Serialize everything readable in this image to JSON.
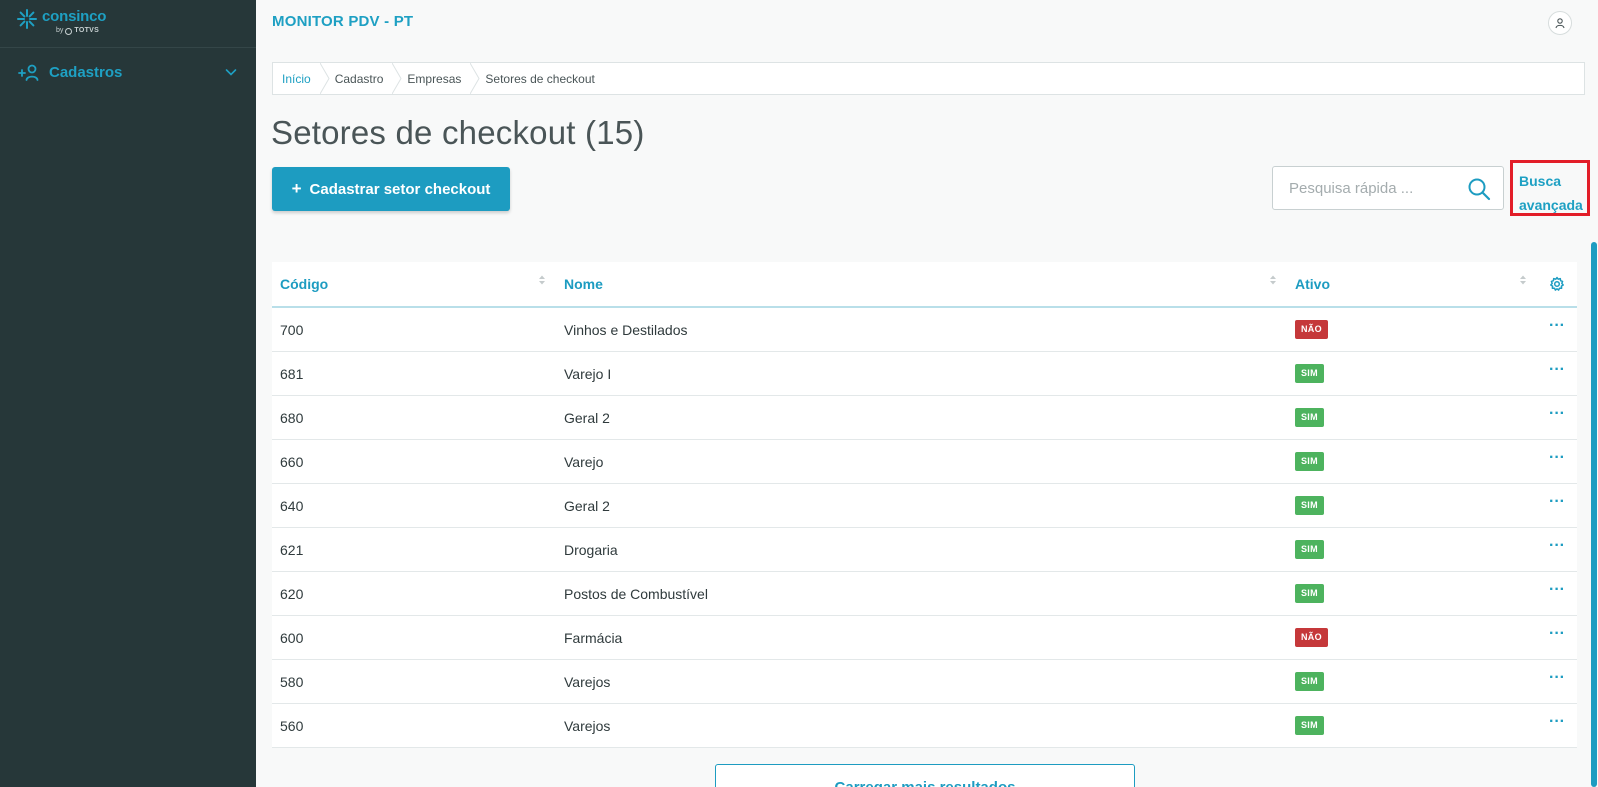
{
  "brand": {
    "name": "consinco",
    "by": "by",
    "parent": "TOTVS",
    "accent": "#1ea0c3"
  },
  "sidebar": {
    "items": [
      {
        "label": "Cadastros",
        "icon": "add-user-icon"
      }
    ]
  },
  "header": {
    "app_title": "MONITOR PDV - PT"
  },
  "breadcrumb": [
    "Início",
    "Cadastro",
    "Empresas",
    "Setores de checkout"
  ],
  "page": {
    "title": "Setores de checkout (15)"
  },
  "toolbar": {
    "add_label": "Cadastrar setor checkout",
    "add_plus": "+",
    "search_placeholder": "Pesquisa rápida ...",
    "advanced_search_line1": "Busca",
    "advanced_search_line2": "avançada"
  },
  "table": {
    "columns": [
      "Código",
      "Nome",
      "Ativo"
    ],
    "rows": [
      {
        "code": "700",
        "name": "Vinhos e Destilados",
        "active": "NÃO"
      },
      {
        "code": "681",
        "name": "Varejo I",
        "active": "SIM"
      },
      {
        "code": "680",
        "name": "Geral 2",
        "active": "SIM"
      },
      {
        "code": "660",
        "name": "Varejo",
        "active": "SIM"
      },
      {
        "code": "640",
        "name": "Geral 2",
        "active": "SIM"
      },
      {
        "code": "621",
        "name": "Drogaria",
        "active": "SIM"
      },
      {
        "code": "620",
        "name": "Postos de Combustível",
        "active": "SIM"
      },
      {
        "code": "600",
        "name": "Farmácia",
        "active": "NÃO"
      },
      {
        "code": "580",
        "name": "Varejos",
        "active": "SIM"
      },
      {
        "code": "560",
        "name": "Varejos",
        "active": "SIM"
      }
    ],
    "row_action": "···"
  },
  "footer": {
    "load_more_label": "Carregar mais resultados"
  },
  "colors": {
    "primary": "#1d9cc1",
    "sidebar_bg": "#263739",
    "badge_yes": "#4db35e",
    "badge_no": "#c5383a",
    "highlight": "#e21d28"
  }
}
